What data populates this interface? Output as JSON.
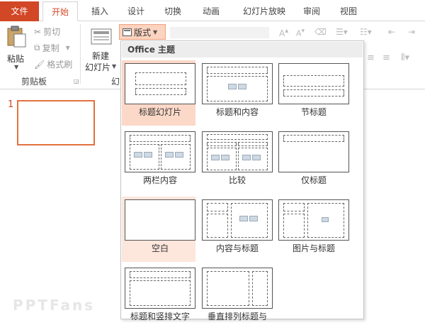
{
  "tabs": {
    "file": "文件",
    "items": [
      "开始",
      "插入",
      "设计",
      "切换",
      "动画",
      "幻灯片放映",
      "审阅",
      "视图"
    ]
  },
  "ribbon": {
    "paste": "粘贴",
    "cut": "剪切",
    "copy": "复制",
    "format_painter": "格式刷",
    "clipboard_group": "剪贴板",
    "new_slide_line1": "新建",
    "new_slide_line2": "幻灯片",
    "slides_group_partial": "幻",
    "layout_button": "版式"
  },
  "slide_panel": {
    "slide_number": "1"
  },
  "watermark": "PPTFans",
  "layout_gallery": {
    "header": "Office 主题",
    "layouts": [
      {
        "label": "标题幻灯片"
      },
      {
        "label": "标题和内容"
      },
      {
        "label": "节标题"
      },
      {
        "label": "两栏内容"
      },
      {
        "label": "比较"
      },
      {
        "label": "仅标题"
      },
      {
        "label": "空白"
      },
      {
        "label": "内容与标题"
      },
      {
        "label": "图片与标题"
      },
      {
        "label": "标题和竖排文字"
      },
      {
        "label": "垂直排列标题与"
      }
    ]
  },
  "colors": {
    "accent": "#d24726",
    "selected_bg": "#fcd8c8",
    "slide_border": "#e2723e"
  }
}
